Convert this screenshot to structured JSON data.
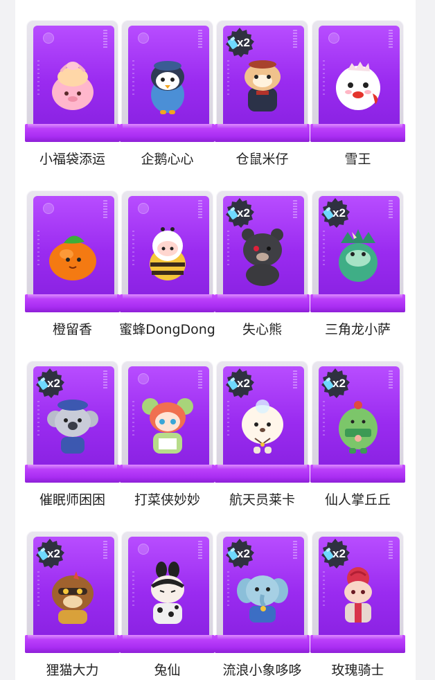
{
  "colors": {
    "box_purple": "#9a2bf0",
    "badge_dark": "#2f3140",
    "badge_light": "#6fd9ff",
    "text": "#222222"
  },
  "items": [
    {
      "name": "小福袋添运",
      "badge": null,
      "icon": "lucky-bag-pig-figure"
    },
    {
      "name": "企鹅心心",
      "badge": null,
      "icon": "penguin-figure"
    },
    {
      "name": "仓鼠米仔",
      "badge": "x2",
      "icon": "hamster-figure"
    },
    {
      "name": "雪王",
      "badge": null,
      "icon": "snow-king-figure"
    },
    {
      "name": "橙留香",
      "badge": null,
      "icon": "orange-figure"
    },
    {
      "name": "蜜蜂DongDong",
      "badge": null,
      "icon": "bee-figure"
    },
    {
      "name": "失心熊",
      "badge": "x2",
      "icon": "dark-bear-figure"
    },
    {
      "name": "三角龙小萨",
      "badge": "x2",
      "icon": "triceratops-figure"
    },
    {
      "name": "催眠师困困",
      "badge": "x2",
      "icon": "koala-figure"
    },
    {
      "name": "打菜侠妙妙",
      "badge": null,
      "icon": "mouse-girl-figure"
    },
    {
      "name": "航天员莱卡",
      "badge": "x2",
      "icon": "astronaut-dog-figure"
    },
    {
      "name": "仙人掌丘丘",
      "badge": "x2",
      "icon": "cactus-figure"
    },
    {
      "name": "狸猫大力",
      "badge": "x2",
      "icon": "raccoon-figure"
    },
    {
      "name": "兔仙",
      "badge": null,
      "icon": "rabbit-figure"
    },
    {
      "name": "流浪小象哆哆",
      "badge": "x2",
      "icon": "elephant-figure"
    },
    {
      "name": "玫瑰骑士",
      "badge": "x2",
      "icon": "rose-knight-figure"
    }
  ]
}
